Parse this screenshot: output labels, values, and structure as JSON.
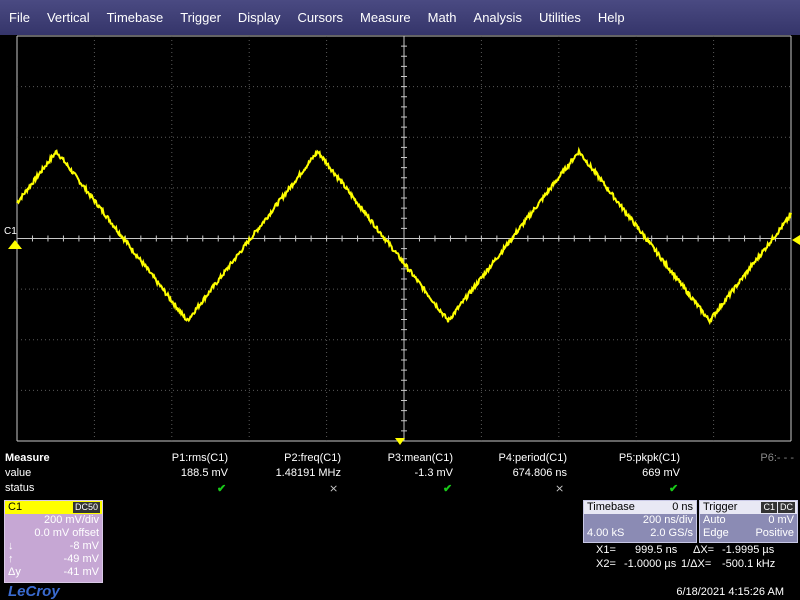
{
  "menu": [
    "File",
    "Vertical",
    "Timebase",
    "Trigger",
    "Display",
    "Cursors",
    "Measure",
    "Math",
    "Analysis",
    "Utilities",
    "Help"
  ],
  "waveform": {
    "channel_label": "C1",
    "color": "#ffff00",
    "grid_color": "#5a5a5a",
    "ref_color": "#c8c8c8",
    "shape": "triangle",
    "peak_mv": 344,
    "trough_mv": -325,
    "first_peak_ns": 777,
    "first_trough_ns": 440,
    "period_ns": 674.806,
    "ns_per_div": 200,
    "mv_per_div": 200
  },
  "measure": {
    "title": "Measure",
    "row_value": "value",
    "row_status": "status",
    "params": [
      {
        "name": "P1:rms(C1)",
        "value": "188.5 mV",
        "status": "ok"
      },
      {
        "name": "P2:freq(C1)",
        "value": "1.48191 MHz",
        "status": "warn"
      },
      {
        "name": "P3:mean(C1)",
        "value": "-1.3 mV",
        "status": "ok"
      },
      {
        "name": "P4:period(C1)",
        "value": "674.806 ns",
        "status": "warn"
      },
      {
        "name": "P5:pkpk(C1)",
        "value": "669 mV",
        "status": "ok"
      }
    ],
    "p6": "P6:- - -"
  },
  "channel": {
    "name": "C1",
    "coupling": "DC50",
    "vdiv": "200 mV/div",
    "offset": "0.0 mV offset",
    "rows": [
      {
        "sym": "↓",
        "val": "-8 mV"
      },
      {
        "sym": "↑",
        "val": "-49 mV"
      },
      {
        "sym": "Δy",
        "val": "-41 mV"
      }
    ]
  },
  "timebase": {
    "title": "Timebase",
    "delay": "0 ns",
    "tdiv": "200 ns/div",
    "samples": "4.00 kS",
    "rate": "2.0 GS/s"
  },
  "trigger": {
    "title": "Trigger",
    "source": "C1",
    "coupling": "DC",
    "mode": "Auto",
    "level": "0 mV",
    "type": "Edge",
    "slope": "Positive"
  },
  "cursors": {
    "x1_label": "X1=",
    "x1": "999.5 ns",
    "dx_label": "ΔX=",
    "dx": "-1.9995 µs",
    "x2_label": "X2=",
    "x2": "-1.0000 µs",
    "inv_dx_label": "1/ΔX=",
    "inv_dx": "-500.1 kHz"
  },
  "brand": "LeCroy",
  "timestamp": "6/18/2021 4:15:26 AM"
}
